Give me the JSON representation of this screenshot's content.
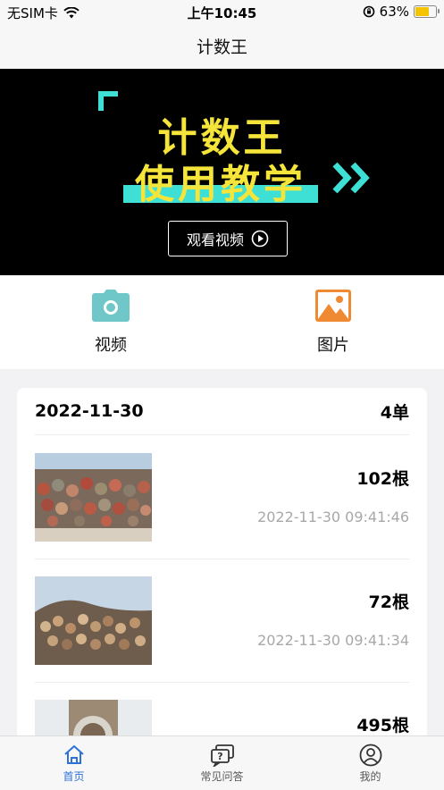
{
  "status_bar": {
    "carrier": "无SIM卡",
    "time": "上午10:45",
    "battery": "63%",
    "battery_level": 0.63
  },
  "nav": {
    "title": "计数王"
  },
  "banner": {
    "title_line1": "计数王",
    "title_line2": "使用教学",
    "button_label": "观看视频",
    "accent_yellow": "#f5e43a",
    "accent_cyan": "#3ee0d6"
  },
  "actions": [
    {
      "label": "视频",
      "icon": "camera-icon",
      "color": "#6fc7c7"
    },
    {
      "label": "图片",
      "icon": "image-icon",
      "color": "#f08a32"
    }
  ],
  "group": {
    "date": "2022-11-30",
    "count": "4单",
    "records": [
      {
        "qty": "102根",
        "time": "2022-11-30 09:41:46"
      },
      {
        "qty": "72根",
        "time": "2022-11-30 09:41:34"
      },
      {
        "qty": "495根",
        "time": ""
      }
    ]
  },
  "tabs": [
    {
      "label": "首页",
      "icon": "home-icon",
      "active": true
    },
    {
      "label": "常见问答",
      "icon": "faq-icon",
      "active": false
    },
    {
      "label": "我的",
      "icon": "profile-icon",
      "active": false
    }
  ],
  "colors": {
    "active_tab": "#2e72d8",
    "muted_text": "#a8a8a8"
  }
}
